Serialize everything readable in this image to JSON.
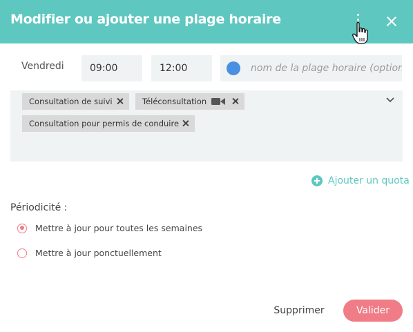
{
  "dialog": {
    "title": "Modifier ou ajouter une plage horaire"
  },
  "slot": {
    "day": "Vendredi",
    "start": "09:00",
    "end": "12:00",
    "name_placeholder": "nom de la plage horaire (optionnel)",
    "color": "#4a90e2"
  },
  "tags": [
    {
      "label": "Consultation de suivi"
    },
    {
      "label": "Téléconsultation"
    },
    {
      "label": "Consultation pour permis de conduire"
    }
  ],
  "quota": {
    "label": "Ajouter un quota"
  },
  "periodicity": {
    "label": "Périodicité :",
    "options": [
      {
        "label": "Mettre à jour pour toutes les semaines",
        "selected": true
      },
      {
        "label": "Mettre à jour ponctuellement",
        "selected": false
      }
    ]
  },
  "actions": {
    "delete_label": "Supprimer",
    "confirm_label": "Valider"
  },
  "theme": {
    "header": "#5ec7c0",
    "accent": "#ef7c86"
  }
}
